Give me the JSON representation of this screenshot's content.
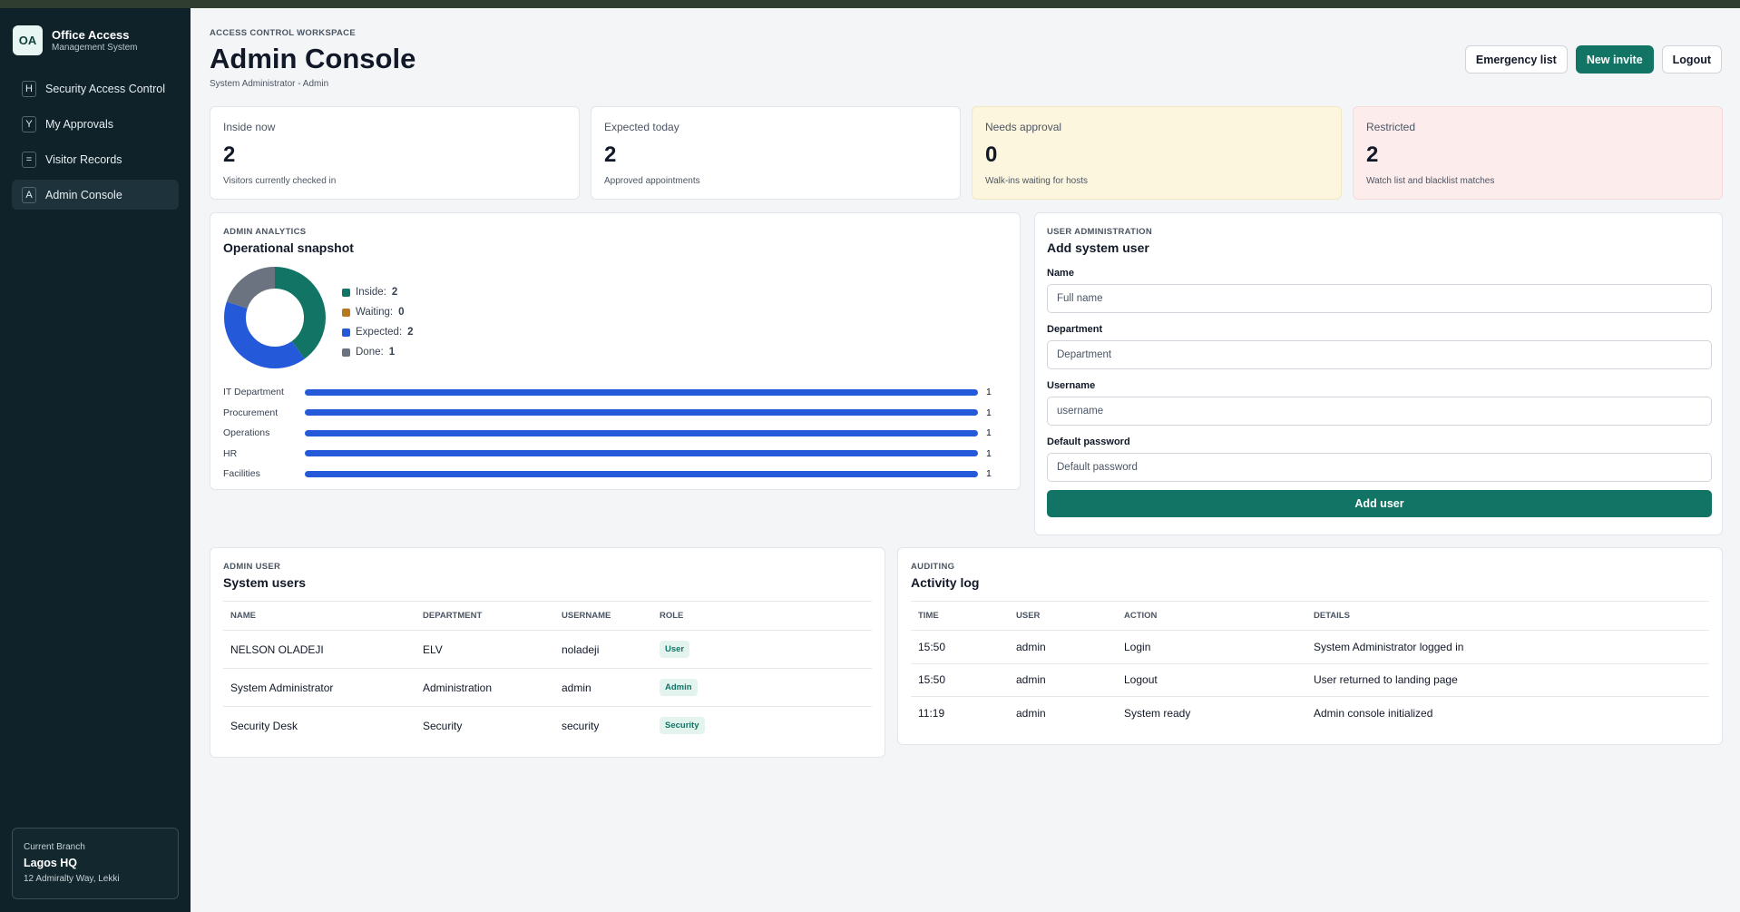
{
  "sidebar": {
    "brand_logo": "OA",
    "brand_title": "Office Access",
    "brand_sub": "Management System",
    "items": [
      {
        "key": "H",
        "label": "Security Access Control",
        "active": false
      },
      {
        "key": "Y",
        "label": "My Approvals",
        "active": false
      },
      {
        "key": "=",
        "label": "Visitor Records",
        "active": false
      },
      {
        "key": "A",
        "label": "Admin Console",
        "active": true
      }
    ],
    "branch": {
      "label": "Current Branch",
      "name": "Lagos HQ",
      "address": "12 Admiralty Way, Lekki"
    }
  },
  "header": {
    "eyebrow": "ACCESS CONTROL WORKSPACE",
    "title": "Admin Console",
    "subtitle": "System Administrator - Admin",
    "buttons": {
      "emergency": "Emergency list",
      "invite": "New invite",
      "logout": "Logout"
    }
  },
  "stats": [
    {
      "label": "Inside now",
      "value": "2",
      "note": "Visitors currently checked in"
    },
    {
      "label": "Expected today",
      "value": "2",
      "note": "Approved appointments"
    },
    {
      "label": "Needs approval",
      "value": "0",
      "note": "Walk-ins waiting for hosts"
    },
    {
      "label": "Restricted",
      "value": "2",
      "note": "Watch list and blacklist matches"
    }
  ],
  "analytics": {
    "eyebrow": "ADMIN ANALYTICS",
    "title": "Operational snapshot",
    "legend": [
      {
        "label": "Inside:",
        "value": "2",
        "color": "#117465"
      },
      {
        "label": "Waiting:",
        "value": "0",
        "color": "#b7791f"
      },
      {
        "label": "Expected:",
        "value": "2",
        "color": "#2459d9"
      },
      {
        "label": "Done:",
        "value": "1",
        "color": "#6b7280"
      }
    ],
    "departments": [
      {
        "label": "IT Department",
        "value": "1",
        "fraction": 1
      },
      {
        "label": "Procurement",
        "value": "1",
        "fraction": 1
      },
      {
        "label": "Operations",
        "value": "1",
        "fraction": 1
      },
      {
        "label": "HR",
        "value": "1",
        "fraction": 1
      },
      {
        "label": "Facilities",
        "value": "1",
        "fraction": 1
      }
    ]
  },
  "user_admin": {
    "eyebrow": "USER ADMINISTRATION",
    "title": "Add system user",
    "fields": [
      {
        "label": "Name",
        "placeholder": "Full name"
      },
      {
        "label": "Department",
        "placeholder": "Department"
      },
      {
        "label": "Username",
        "placeholder": "username"
      },
      {
        "label": "Default password",
        "placeholder": "Default password"
      }
    ],
    "submit": "Add user"
  },
  "users": {
    "eyebrow": "ADMIN USER",
    "title": "System users",
    "columns": [
      "NAME",
      "DEPARTMENT",
      "USERNAME",
      "ROLE"
    ],
    "rows": [
      {
        "name": "NELSON OLADEJI",
        "department": "ELV",
        "username": "noladeji",
        "role": "User"
      },
      {
        "name": "System Administrator",
        "department": "Administration",
        "username": "admin",
        "role": "Admin"
      },
      {
        "name": "Security Desk",
        "department": "Security",
        "username": "security",
        "role": "Security"
      }
    ]
  },
  "activity": {
    "eyebrow": "AUDITING",
    "title": "Activity log",
    "columns": [
      "TIME",
      "USER",
      "ACTION",
      "DETAILS"
    ],
    "rows": [
      {
        "time": "15:50",
        "user": "admin",
        "action": "Login",
        "details": "System Administrator logged in"
      },
      {
        "time": "15:50",
        "user": "admin",
        "action": "Logout",
        "details": "User returned to landing page"
      },
      {
        "time": "11:19",
        "user": "admin",
        "action": "System ready",
        "details": "Admin console initialized"
      }
    ]
  }
}
